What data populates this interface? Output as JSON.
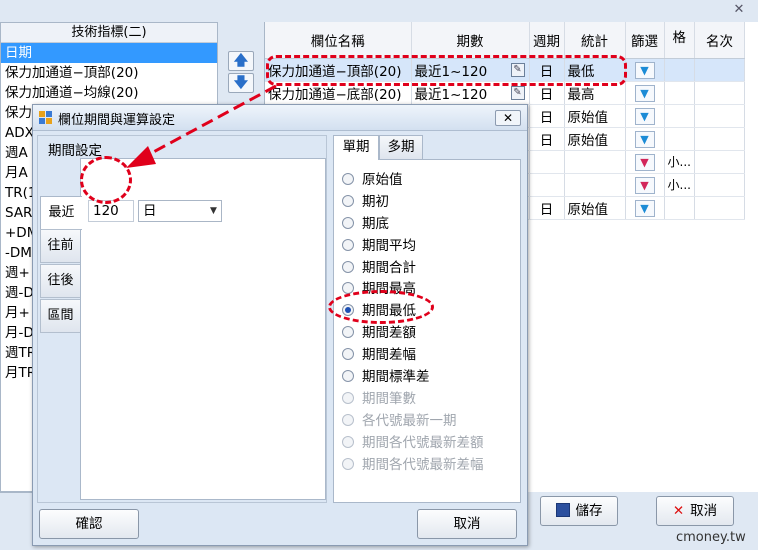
{
  "left_panel": {
    "header": "技術指標(二)",
    "items": [
      {
        "label": "日期",
        "selected": true
      },
      {
        "label": "保力加通道−頂部(20)"
      },
      {
        "label": "保力加通道−均線(20)"
      },
      {
        "label": "保力"
      },
      {
        "label": "ADX"
      },
      {
        "label": "週A"
      },
      {
        "label": "月A"
      },
      {
        "label": "TR(1"
      },
      {
        "label": "SAR"
      },
      {
        "label": "+DM"
      },
      {
        "label": "-DM"
      },
      {
        "label": "週+"
      },
      {
        "label": "週-D"
      },
      {
        "label": "月+"
      },
      {
        "label": "月-D"
      },
      {
        "label": "週TR"
      },
      {
        "label": "月TR"
      }
    ]
  },
  "grid": {
    "columns": [
      "欄位名稱",
      "期數",
      "週期",
      "統計",
      "篩選",
      "格",
      "名次"
    ],
    "rows": [
      {
        "name": "保力加通道−頂部(20)",
        "period": "最近1~120",
        "cycle": "日",
        "stat": "最低",
        "filter": "blue",
        "grid": "",
        "highlight": true
      },
      {
        "name": "保力加通道−底部(20)",
        "period": "最近1~120",
        "cycle": "日",
        "stat": "最高",
        "filter": "blue",
        "grid": ""
      },
      {
        "name": "",
        "period": "",
        "cycle": "日",
        "stat": "原始值",
        "filter": "blue",
        "grid": ""
      },
      {
        "name": "",
        "period": "",
        "cycle": "日",
        "stat": "原始值",
        "filter": "blue",
        "grid": ""
      },
      {
        "name": "",
        "period": "",
        "cycle": "",
        "stat": "",
        "filter": "red",
        "grid": "小..."
      },
      {
        "name": "",
        "period": "",
        "cycle": "",
        "stat": "",
        "filter": "red",
        "grid": "小..."
      },
      {
        "name": "",
        "period": "",
        "cycle": "日",
        "stat": "原始值",
        "filter": "blue",
        "grid": ""
      }
    ]
  },
  "buttons": {
    "save": "儲存",
    "cancel": "取消",
    "move_up_icon": "arrow-up-icon",
    "move_down_icon": "arrow-down-icon"
  },
  "dialog": {
    "title": "欄位期間與運算設定",
    "close_label": "✕",
    "period_group": {
      "label": "期間設定",
      "tabs": [
        "最近",
        "往前",
        "往後",
        "區間"
      ],
      "recent_value": "120",
      "unit": "日"
    },
    "calc_tabs": [
      "單期",
      "多期"
    ],
    "options": [
      {
        "label": "原始值",
        "enabled": true
      },
      {
        "label": "期初",
        "enabled": true
      },
      {
        "label": "期底",
        "enabled": true
      },
      {
        "label": "期間平均",
        "enabled": true
      },
      {
        "label": "期間合計",
        "enabled": true
      },
      {
        "label": "期間最高",
        "enabled": true
      },
      {
        "label": "期間最低",
        "enabled": true,
        "checked": true
      },
      {
        "label": "期間差額",
        "enabled": true
      },
      {
        "label": "期間差幅",
        "enabled": true
      },
      {
        "label": "期間標準差",
        "enabled": true
      },
      {
        "label": "期間筆數",
        "enabled": false
      },
      {
        "label": "各代號最新一期",
        "enabled": false
      },
      {
        "label": "期間各代號最新差額",
        "enabled": false
      },
      {
        "label": "期間各代號最新差幅",
        "enabled": false
      }
    ],
    "confirm": "確認",
    "cancel": "取消"
  },
  "watermark": "cmoney.tw",
  "colors": {
    "annotation": "#e0001b",
    "selection": "#3399ff",
    "dialog_bg": "#dce7f4"
  }
}
